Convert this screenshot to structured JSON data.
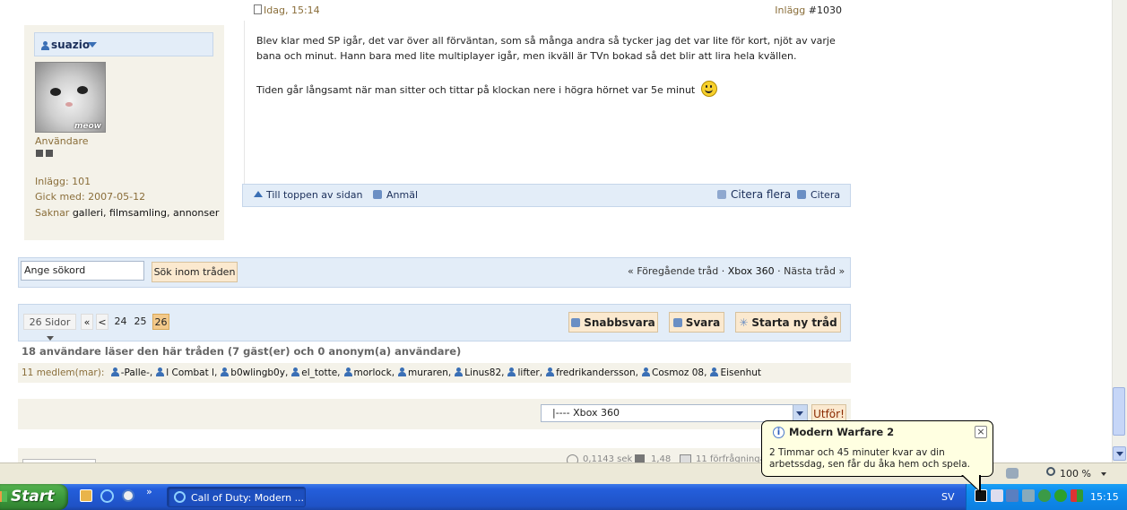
{
  "post": {
    "date": "Idag, 15:14",
    "post_label": "Inlägg",
    "post_number": "#1030",
    "paragraph1": "Blev klar med SP igår, det var över all förväntan, som så många andra så tycker jag det var lite för kort, njöt av varje bana och minut. Hann bara med lite multiplayer igår, men ikväll är TVn bokad så det blir att lira hela kvällen.",
    "paragraph2": "Tiden går långsamt när man sitter och tittar på klockan nere i högra hörnet var 5e minut",
    "footer_top": "Till toppen av sidan",
    "footer_report": "Anmäl",
    "footer_quote_multi": "Citera flera",
    "footer_quote": "Citera"
  },
  "user": {
    "name": "suazio",
    "avatar_caption": "meow",
    "role": "Användare",
    "posts": "Inlägg: 101",
    "joined": "Gick med: 2007-05-12",
    "missing_label": "Saknar",
    "missing_galleri": "galleri",
    "missing_filmsamling": "filmsamling",
    "missing_annonser": "annonser"
  },
  "search": {
    "value": "Ange sökord",
    "button": "Sök inom tråden",
    "prev": "« Föregående tråd",
    "thread": "Xbox 360",
    "next": "Nästa tråd »"
  },
  "pagination": {
    "pages_label": "26 Sidor",
    "first": "«",
    "prev": "<",
    "p24": "24",
    "p25": "25",
    "p26": "26"
  },
  "actions": {
    "quick_reply": "Snabbsvara",
    "reply": "Svara",
    "new_thread": "Starta ny tråd"
  },
  "readers": {
    "summary": "18 användare läser den här tråden (7 gäst(er) och 0 anonym(a) användare)",
    "members_label": "11 medlem(mar):",
    "members": [
      "-Palle-",
      "l Combat l",
      "b0wlingb0y",
      "el_totte",
      "morlock",
      "muraren",
      "Linus82",
      "lifter",
      "fredrikandersson",
      "Cosmoz 08",
      "Eisenhut"
    ]
  },
  "jump": {
    "selected": "|---- Xbox 360",
    "button": "Utför!"
  },
  "partial": {
    "time": "0,1143 sek",
    "load": "1,48",
    "queries": "11 förfrågningar"
  },
  "status_bar": {
    "zoom": "100 %"
  },
  "balloon": {
    "title": "Modern Warfare 2",
    "text": "2 Timmar och 45 minuter kvar av din arbetssdag, sen får du åka hem och spela."
  },
  "taskbar": {
    "start": "Start",
    "window": "Call of Duty: Modern ...",
    "language": "SV",
    "clock": "15:15"
  },
  "colors": {
    "panel": "#f4f2e9",
    "blue_bar": "#e3edf8",
    "taskbar": "#245edb",
    "start": "#3c9a3c",
    "tray": "#0f8ef0",
    "current_page": "#f3c98a"
  }
}
